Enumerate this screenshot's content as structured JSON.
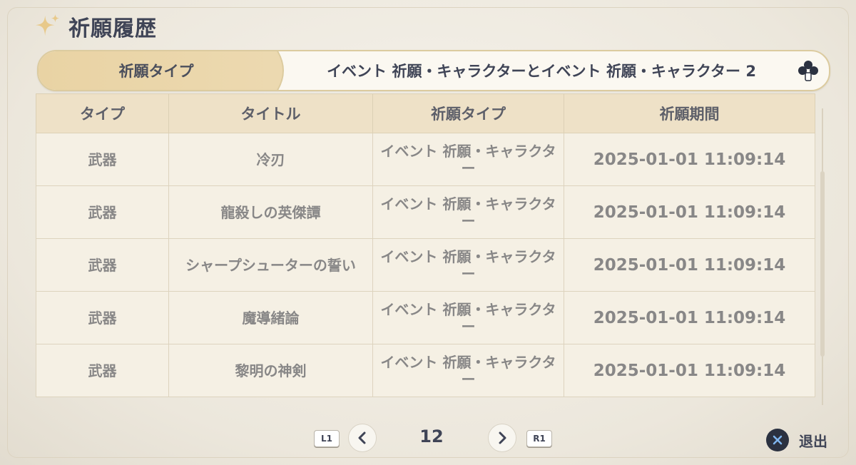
{
  "page": {
    "title": "祈願履歴"
  },
  "filter": {
    "label": "祈願タイプ",
    "value": "イベント 祈願・キャラクターとイベント 祈願・キャラクター 2"
  },
  "table": {
    "headers": [
      "タイプ",
      "タイトル",
      "祈願タイプ",
      "祈願期間"
    ],
    "rows": [
      [
        "武器",
        "冷刃",
        "イベント 祈願・キャラクター",
        "2025-01-01 11:09:14"
      ],
      [
        "武器",
        "龍殺しの英傑譚",
        "イベント 祈願・キャラクター",
        "2025-01-01 11:09:14"
      ],
      [
        "武器",
        "シャープシューターの誓い",
        "イベント 祈願・キャラクター",
        "2025-01-01 11:09:14"
      ],
      [
        "武器",
        "魔導緒論",
        "イベント 祈願・キャラクター",
        "2025-01-01 11:09:14"
      ],
      [
        "武器",
        "黎明の神剣",
        "イベント 祈願・キャラクター",
        "2025-01-01 11:09:14"
      ]
    ]
  },
  "pagination": {
    "prev_key": "L1",
    "next_key": "R1",
    "current_page": "12"
  },
  "footer": {
    "exit_label": "退出"
  },
  "icons": {
    "title": "sparkle-icon",
    "filter_button": "clover-icon",
    "prev": "chevron-left-icon",
    "next": "chevron-right-icon",
    "exit": "cross-button-icon"
  },
  "colors": {
    "accent_gold": "#e9d3a4",
    "header_bg": "#eee1c7",
    "row_bg": "#f5f0e4",
    "text_dark": "#3f4456",
    "text_muted": "#888787"
  }
}
